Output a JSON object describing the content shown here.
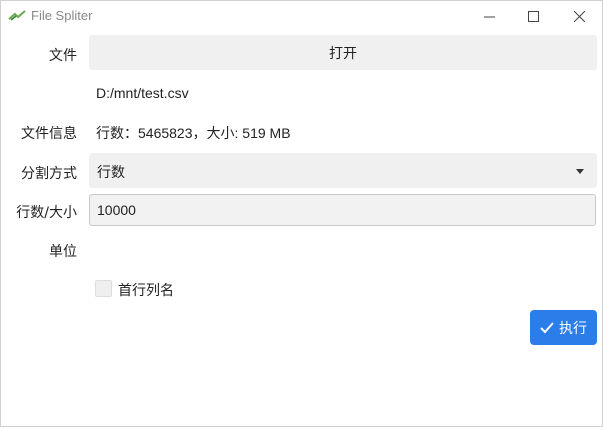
{
  "window": {
    "title": "File Spliter"
  },
  "form": {
    "file_label": "文件",
    "open_label": "打开",
    "file_path": "D:/mnt/test.csv",
    "info_label": "文件信息",
    "info_text": "行数：5465823，大小: 519 MB",
    "split_label": "分割方式",
    "split_value": "行数",
    "size_label": "行数/大小",
    "size_value": "10000",
    "unit_label": "单位",
    "header_checkbox_label": "首行列名",
    "header_checked": false,
    "run_label": "执行"
  },
  "colors": {
    "accent": "#2b7de9",
    "field_bg": "#f0f0f0"
  },
  "icons": {
    "run": "check-icon",
    "app": "app-logo-icon"
  }
}
